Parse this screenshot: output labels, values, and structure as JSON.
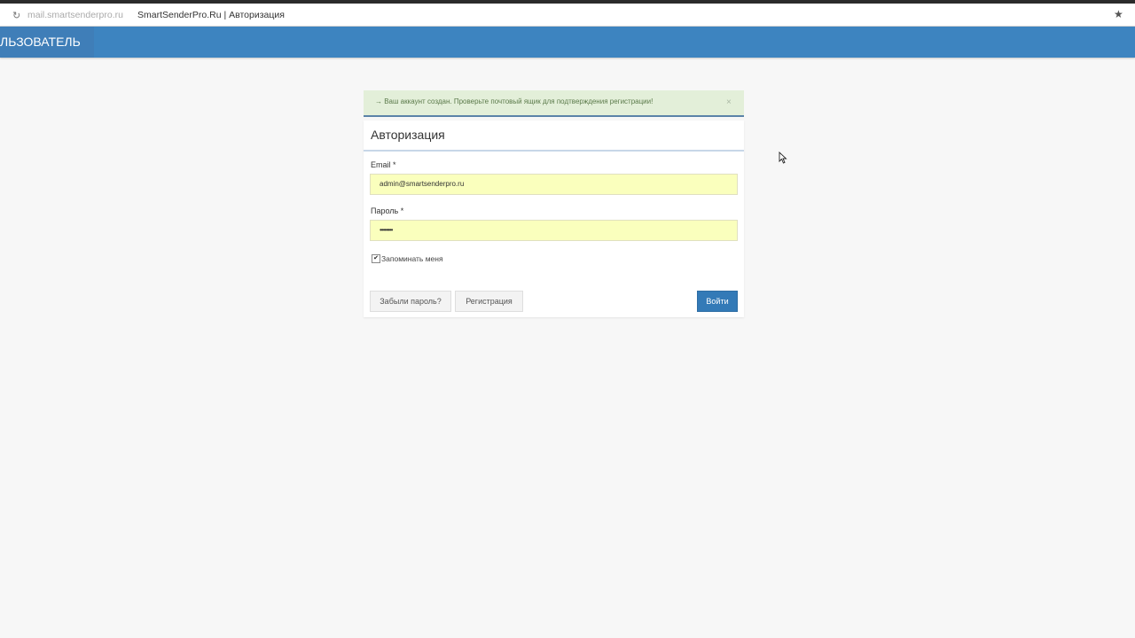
{
  "browser": {
    "reload_icon": "reload-icon",
    "domain": "mail.smartsenderpro.ru",
    "title": "SmartSenderPro.Ru | Авторизация",
    "star_icon": "star-icon"
  },
  "navbar": {
    "user_label": "ЛЬЗОВАТЕЛЬ",
    "color": "#3d84c0"
  },
  "alert": {
    "message": "→ Ваш аккаунт создан. Проверьте почтовый ящик для подтверждения регистрации!",
    "close": "×"
  },
  "login": {
    "title": "Авторизация",
    "email_label": "Email *",
    "email_value": "admin@smartsenderpro.ru",
    "password_label": "Пароль *",
    "password_value": "••••••••",
    "remember_label": "Запоминать меня",
    "remember_checked": true,
    "forgot_button": "Забыли пароль?",
    "register_button": "Регистрация",
    "submit_button": "Войти"
  }
}
